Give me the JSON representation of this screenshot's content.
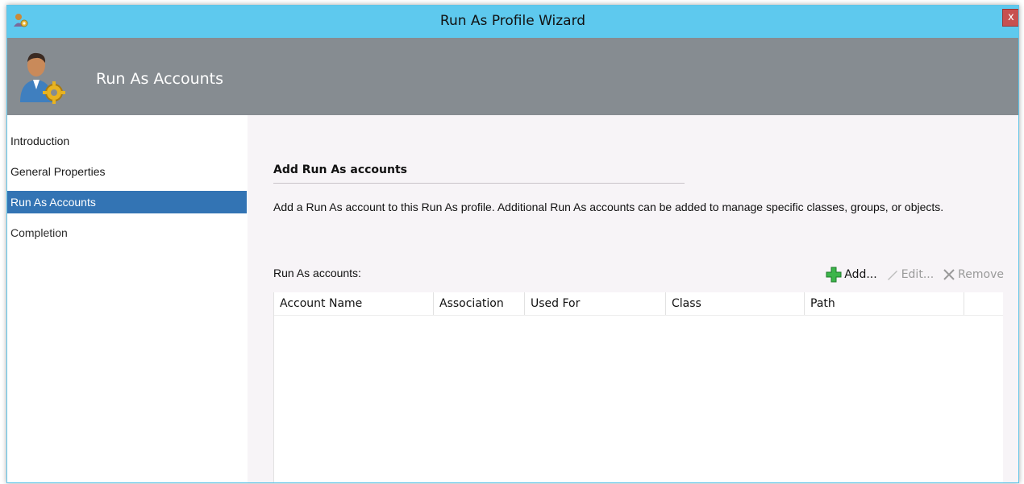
{
  "window": {
    "title": "Run As Profile Wizard",
    "close_glyph": "x"
  },
  "header": {
    "title": "Run As Accounts",
    "icon": "user-gear-icon"
  },
  "nav": {
    "items": [
      {
        "label": "Introduction",
        "state": "done"
      },
      {
        "label": "General Properties",
        "state": "done"
      },
      {
        "label": "Run As Accounts",
        "state": "active"
      },
      {
        "label": "Completion",
        "state": "pending"
      }
    ]
  },
  "main": {
    "section_title": "Add Run As accounts",
    "description": "Add a Run As account to this Run As profile.  Additional Run As accounts can be added to manage specific classes, groups, or objects.",
    "list_label": "Run As accounts:",
    "toolbar": {
      "add_label": "Add...",
      "edit_label": "Edit...",
      "remove_label": "Remove"
    },
    "grid": {
      "columns": [
        "Account Name",
        "Association",
        "Used For",
        "Class",
        "Path"
      ],
      "rows": []
    }
  },
  "colors": {
    "titlebar": "#5ec9ee",
    "header": "#868c91",
    "nav_selected": "#3374b4",
    "add_icon": "#3cb54a"
  }
}
